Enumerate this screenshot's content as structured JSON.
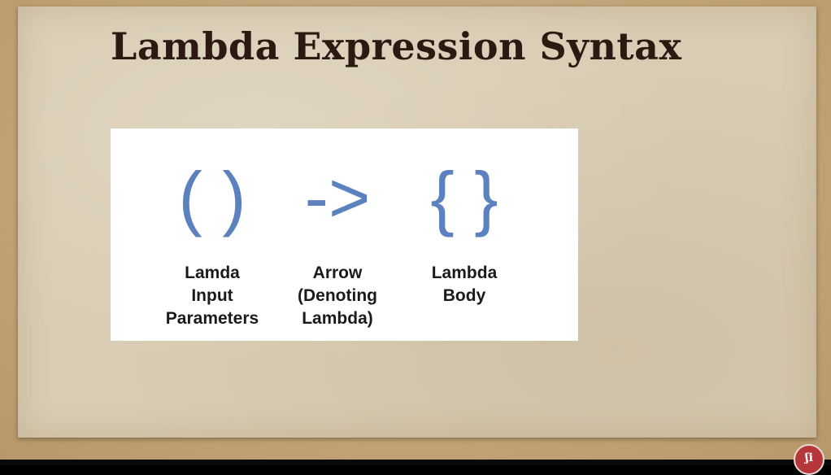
{
  "slide": {
    "title": "Lambda Expression Syntax"
  },
  "figure": {
    "columns": [
      {
        "symbol": "( )",
        "caption_lines": [
          "Lamda",
          "Input",
          "Parameters"
        ]
      },
      {
        "symbol": "->",
        "caption_lines": [
          "Arrow",
          "(Denoting",
          "Lambda)"
        ]
      },
      {
        "symbol": "{ }",
        "caption_lines": [
          "Lambda",
          "Body"
        ]
      }
    ]
  },
  "colors": {
    "symbol_blue": "#5b82be",
    "title_brown": "#2a1a12",
    "paper": "#d9ccb3",
    "logo_red": "#b5373a"
  },
  "icons": {
    "logo": "channel-logo-icon"
  }
}
